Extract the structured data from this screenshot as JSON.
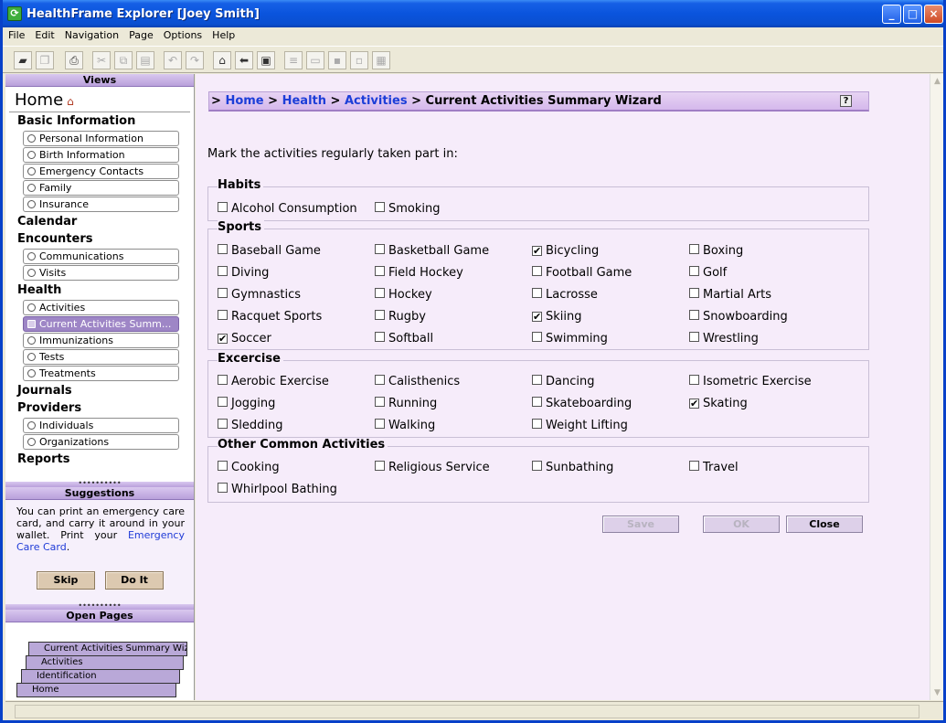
{
  "window": {
    "title": "HealthFrame Explorer [Joey Smith]"
  },
  "menu": [
    "File",
    "Edit",
    "Navigation",
    "Page",
    "Options",
    "Help"
  ],
  "sidebar": {
    "views_label": "Views",
    "home_label": "Home",
    "sections": {
      "basic": "Basic Information",
      "calendar": "Calendar",
      "encounters": "Encounters",
      "health": "Health",
      "journals": "Journals",
      "providers": "Providers",
      "reports": "Reports"
    },
    "basic_items": [
      "Personal Information",
      "Birth Information",
      "Emergency Contacts",
      "Family",
      "Insurance"
    ],
    "encounter_items": [
      "Communications",
      "Visits"
    ],
    "health_items": [
      "Activities",
      "Current Activities Summ...",
      "Immunizations",
      "Tests",
      "Treatments"
    ],
    "provider_items": [
      "Individuals",
      "Organizations"
    ],
    "suggestions_label": "Suggestions",
    "suggestion_text": "You can print an emergency care card, and carry it around in your wallet. Print your",
    "suggestion_link": "Emergency Care Card",
    "suggestion_end": ".",
    "skip_label": "Skip",
    "doit_label": "Do It",
    "open_pages_label": "Open Pages",
    "open_pages": [
      "Current Activities Summary Wiz...",
      "Activities",
      "Identification",
      "Home"
    ]
  },
  "breadcrumb": {
    "prefix": ">",
    "home": "Home",
    "health": "Health",
    "activities": "Activities",
    "sep": ">",
    "current": "Current Activities Summary Wizard",
    "help": "?"
  },
  "intro": "Mark the activities regularly taken part in:",
  "groups": {
    "habits": {
      "title": "Habits",
      "items": [
        {
          "label": "Alcohol Consumption",
          "checked": false
        },
        {
          "label": "Smoking",
          "checked": false
        }
      ]
    },
    "sports": {
      "title": "Sports",
      "items": [
        {
          "label": "Baseball Game",
          "checked": false
        },
        {
          "label": "Basketball Game",
          "checked": false
        },
        {
          "label": "Bicycling",
          "checked": true
        },
        {
          "label": "Boxing",
          "checked": false
        },
        {
          "label": "Diving",
          "checked": false
        },
        {
          "label": "Field Hockey",
          "checked": false
        },
        {
          "label": "Football Game",
          "checked": false
        },
        {
          "label": "Golf",
          "checked": false
        },
        {
          "label": "Gymnastics",
          "checked": false
        },
        {
          "label": "Hockey",
          "checked": false
        },
        {
          "label": "Lacrosse",
          "checked": false
        },
        {
          "label": "Martial Arts",
          "checked": false
        },
        {
          "label": "Racquet Sports",
          "checked": false
        },
        {
          "label": "Rugby",
          "checked": false
        },
        {
          "label": "Skiing",
          "checked": true
        },
        {
          "label": "Snowboarding",
          "checked": false
        },
        {
          "label": "Soccer",
          "checked": true
        },
        {
          "label": "Softball",
          "checked": false
        },
        {
          "label": "Swimming",
          "checked": false
        },
        {
          "label": "Wrestling",
          "checked": false
        }
      ]
    },
    "exercise": {
      "title": "Excercise",
      "items": [
        {
          "label": "Aerobic Exercise",
          "checked": false
        },
        {
          "label": "Calisthenics",
          "checked": false
        },
        {
          "label": "Dancing",
          "checked": false
        },
        {
          "label": "Isometric Exercise",
          "checked": false
        },
        {
          "label": "Jogging",
          "checked": false
        },
        {
          "label": "Running",
          "checked": false
        },
        {
          "label": "Skateboarding",
          "checked": false
        },
        {
          "label": "Skating",
          "checked": true
        },
        {
          "label": "Sledding",
          "checked": false
        },
        {
          "label": "Walking",
          "checked": false
        },
        {
          "label": "Weight Lifting",
          "checked": false
        }
      ]
    },
    "other": {
      "title": "Other Common Activities",
      "items": [
        {
          "label": "Cooking",
          "checked": false
        },
        {
          "label": "Religious Service",
          "checked": false
        },
        {
          "label": "Sunbathing",
          "checked": false
        },
        {
          "label": "Travel",
          "checked": false
        },
        {
          "label": "Whirlpool Bathing",
          "checked": false
        }
      ]
    }
  },
  "actions": {
    "save": "Save",
    "ok": "OK",
    "close": "Close"
  },
  "check_glyph": "✔"
}
